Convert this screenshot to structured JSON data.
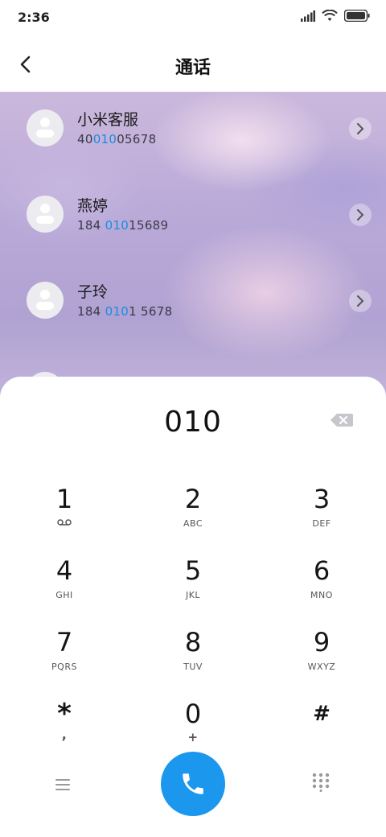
{
  "status_bar": {
    "time": "2:36"
  },
  "header": {
    "title": "通话"
  },
  "contacts": [
    {
      "name": "小米客服",
      "num_pre": "40",
      "num_hl": "010",
      "num_post": "05678"
    },
    {
      "name": "燕婷",
      "num_pre": "184 ",
      "num_hl": "010",
      "num_post": "15689"
    },
    {
      "name": "子玲",
      "num_pre": "184 ",
      "num_hl": "010",
      "num_post": "1 5678"
    }
  ],
  "dial": {
    "entered": "010"
  },
  "keypad": [
    {
      "digit": "1",
      "letters": ""
    },
    {
      "digit": "2",
      "letters": "ABC"
    },
    {
      "digit": "3",
      "letters": "DEF"
    },
    {
      "digit": "4",
      "letters": "GHI"
    },
    {
      "digit": "5",
      "letters": "JKL"
    },
    {
      "digit": "6",
      "letters": "MNO"
    },
    {
      "digit": "7",
      "letters": "PQRS"
    },
    {
      "digit": "8",
      "letters": "TUV"
    },
    {
      "digit": "9",
      "letters": "WXYZ"
    },
    {
      "digit": "*",
      "letters": ","
    },
    {
      "digit": "0",
      "letters": "+"
    },
    {
      "digit": "#",
      "letters": ""
    }
  ],
  "icons": {
    "back": "back-arrow-icon",
    "chevron": "chevron-right-icon",
    "voicemail": "voicemail-icon",
    "backspace": "backspace-icon",
    "menu": "menu-icon",
    "call": "phone-icon",
    "dialpad": "dialpad-icon"
  },
  "colors": {
    "accent": "#1c97ee",
    "highlight": "#1a8de0"
  }
}
